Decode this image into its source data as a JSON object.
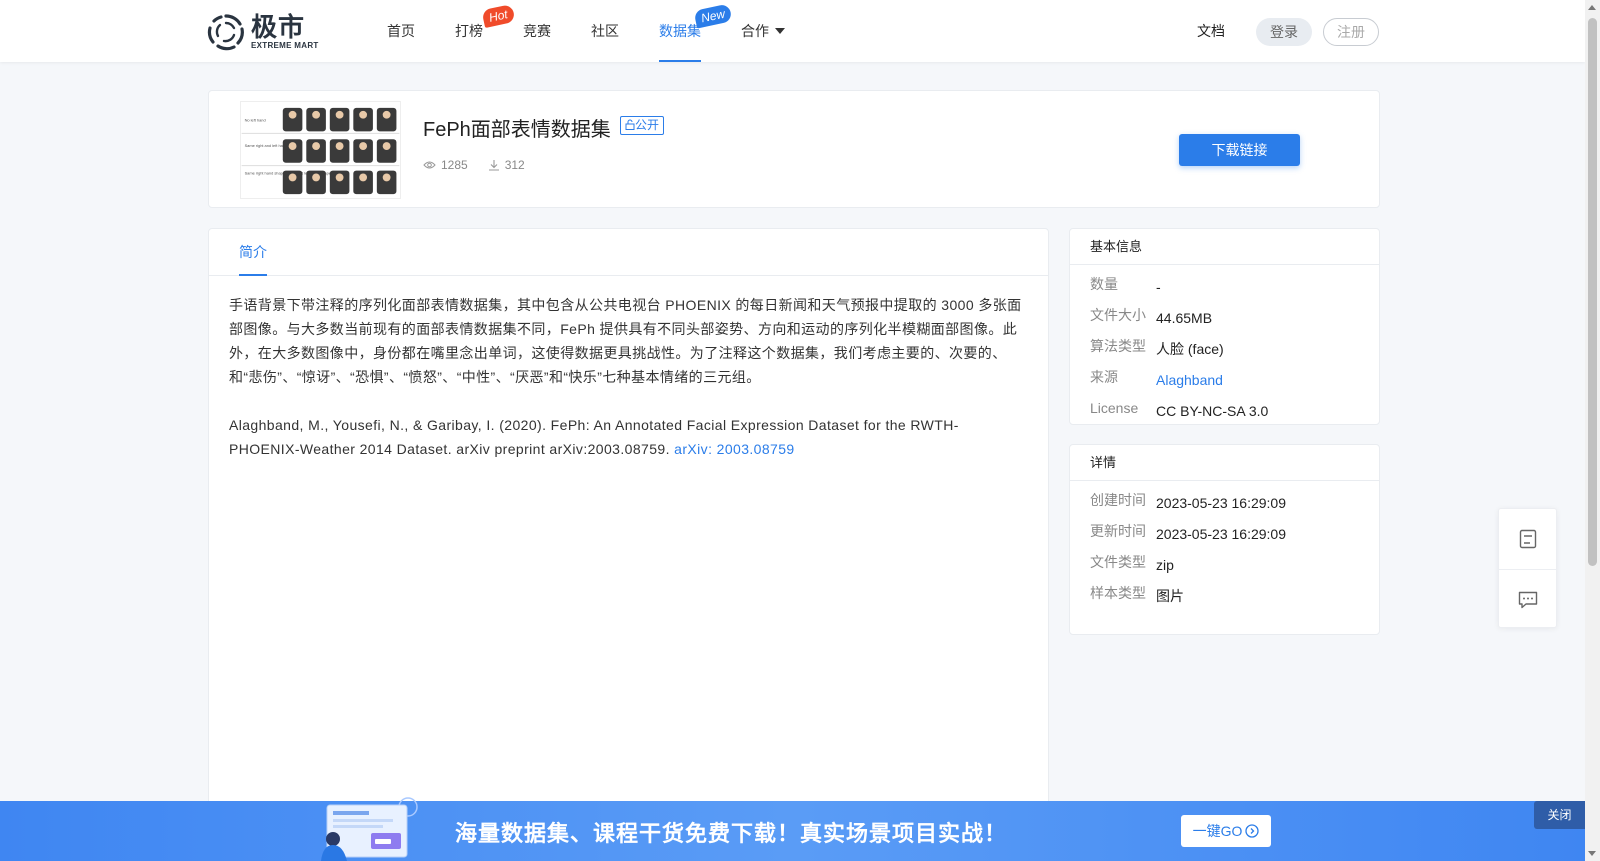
{
  "brand": {
    "name_cn": "极市",
    "name_en": "EXTREME MART"
  },
  "nav": {
    "items": [
      {
        "label": "首页"
      },
      {
        "label": "打榜",
        "badge": "Hot"
      },
      {
        "label": "竞赛"
      },
      {
        "label": "社区"
      },
      {
        "label": "数据集",
        "badge": "New",
        "active": true
      },
      {
        "label": "合作"
      }
    ],
    "docs": "文档",
    "login": "登录",
    "register": "注册"
  },
  "dataset": {
    "title": "FePh面部表情数据集",
    "visibility": "公开",
    "views": "1285",
    "downloads": "312",
    "download_button": "下载链接"
  },
  "tabs": {
    "intro": "简介"
  },
  "intro": {
    "paragraph1": "手语背景下带注释的序列化面部表情数据集，其中包含从公共电视台 PHOENIX 的每日新闻和天气预报中提取的 3000 多张面部图像。与大多数当前现有的面部表情数据集不同，FePh 提供具有不同头部姿势、方向和运动的序列化半模糊面部图像。此外，在大多数图像中，身份都在嘴里念出单词，这使得数据更具挑战性。为了注释这个数据集，我们考虑主要的、次要的、和“悲伤”、“惊讶”、“恐惧”、“愤怒”、“中性”、“厌恶”和“快乐”七种基本情绪的三元组。",
    "citation": "Alaghband, M., Yousefi, N., & Garibay, I. (2020). FePh: An Annotated Facial Expression Dataset for the RWTH-PHOENIX-Weather 2014 Dataset. arXiv preprint arXiv:2003.08759. ",
    "citation_link": "arXiv: 2003.08759"
  },
  "basic_info": {
    "title": "基本信息",
    "rows": [
      {
        "key": "数量",
        "value": "-"
      },
      {
        "key": "文件大小",
        "value": "44.65MB"
      },
      {
        "key": "算法类型",
        "value": "人脸 (face)"
      },
      {
        "key": "来源",
        "value": "Alaghband"
      },
      {
        "key": "License",
        "value": "CC BY-NC-SA 3.0"
      }
    ]
  },
  "details": {
    "title": "详情",
    "rows": [
      {
        "key": "创建时间",
        "value": "2023-05-23 16:29:09"
      },
      {
        "key": "更新时间",
        "value": "2023-05-23 16:29:09"
      },
      {
        "key": "文件类型",
        "value": "zip"
      },
      {
        "key": "样本类型",
        "value": "图片"
      }
    ]
  },
  "thumbnail_labels": [
    "No left hand",
    "Same right and left hand shapes",
    "Same right hand shapes, different left hand shapes"
  ],
  "banner": {
    "text": "海量数据集、课程干货免费下载！真实场景项目实战！",
    "go_button": "一键GO",
    "close": "关闭"
  },
  "colors": {
    "accent": "#2b7de9",
    "hot": "#f04b2a",
    "banner": "#4a8ff4"
  }
}
